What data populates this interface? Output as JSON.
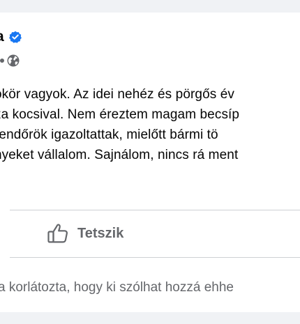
{
  "post": {
    "author_fragment": "a",
    "body_lines": [
      "ökör vagyok. Az idei nehéz és pörgős év",
      "za kocsival. Nem éreztem magam becsíp",
      " rendőrök igazoltattak, mielőtt bármi tö",
      "nyeket vállalom. Sajnálom, nincs rá ment"
    ],
    "icons": {
      "verified": "verified-badge-icon",
      "audience": "globe-icon",
      "like": "thumbs-up-icon"
    }
  },
  "actions": {
    "like_label": "Tetszik"
  },
  "comments": {
    "restriction_notice": "a korlátozta, hogy ki szólhat hozzá ehhe"
  },
  "colors": {
    "background": "#f0f2f5",
    "card": "#ffffff",
    "text": "#050505",
    "secondary_text": "#65676b",
    "verified_blue": "#1877f2",
    "divider": "#ced0d4"
  }
}
